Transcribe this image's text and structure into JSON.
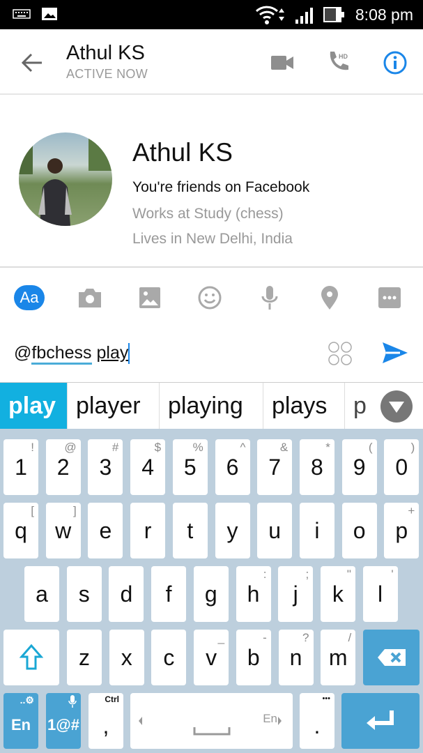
{
  "status_bar": {
    "time": "8:08 pm",
    "icons": [
      "keyboard-icon",
      "image-icon",
      "wifi-icon",
      "signal-icon",
      "battery-icon"
    ]
  },
  "header": {
    "title": "Athul KS",
    "subtitle": "ACTIVE NOW",
    "accent": "#1a86e8"
  },
  "profile": {
    "name": "Athul KS",
    "line1": "You're friends on Facebook",
    "line2": "Works at Study (chess)",
    "line3": "Lives in New Delhi, India"
  },
  "toolbar": {
    "text_label": "Aa"
  },
  "composer": {
    "prefix": "@",
    "mention": "fbchess",
    "text": "play"
  },
  "suggestions": [
    "play",
    "player",
    "playing",
    "plays",
    "p"
  ],
  "keyboard": {
    "rows": [
      [
        [
          "1",
          "!"
        ],
        [
          "2",
          "@"
        ],
        [
          "3",
          "#"
        ],
        [
          "4",
          "$"
        ],
        [
          "5",
          "%"
        ],
        [
          "6",
          "^"
        ],
        [
          "7",
          "&"
        ],
        [
          "8",
          "*"
        ],
        [
          "9",
          "("
        ],
        [
          "0",
          ")"
        ]
      ],
      [
        [
          "q",
          "["
        ],
        [
          "w",
          "]"
        ],
        [
          "e",
          ""
        ],
        [
          "r",
          ""
        ],
        [
          "t",
          ""
        ],
        [
          "y",
          ""
        ],
        [
          "u",
          ""
        ],
        [
          "i",
          ""
        ],
        [
          "o",
          ""
        ],
        [
          "p",
          "+"
        ]
      ],
      [
        [
          "a",
          ""
        ],
        [
          "s",
          ""
        ],
        [
          "d",
          ""
        ],
        [
          "f",
          ""
        ],
        [
          "g",
          ""
        ],
        [
          "h",
          ":"
        ],
        [
          "j",
          ";"
        ],
        [
          "k",
          "\""
        ],
        [
          "l",
          "'"
        ]
      ],
      [
        [
          "z",
          ""
        ],
        [
          "x",
          ""
        ],
        [
          "c",
          ""
        ],
        [
          "v",
          "_"
        ],
        [
          "b",
          "-"
        ],
        [
          "n",
          "?"
        ],
        [
          "m",
          "/"
        ]
      ]
    ],
    "lang_key": "En",
    "symbols_key": "1@#",
    "comma": ",",
    "comma_alt": "Ctrl",
    "space_lang": "En",
    "period": ".",
    "period_alt": "•••"
  }
}
